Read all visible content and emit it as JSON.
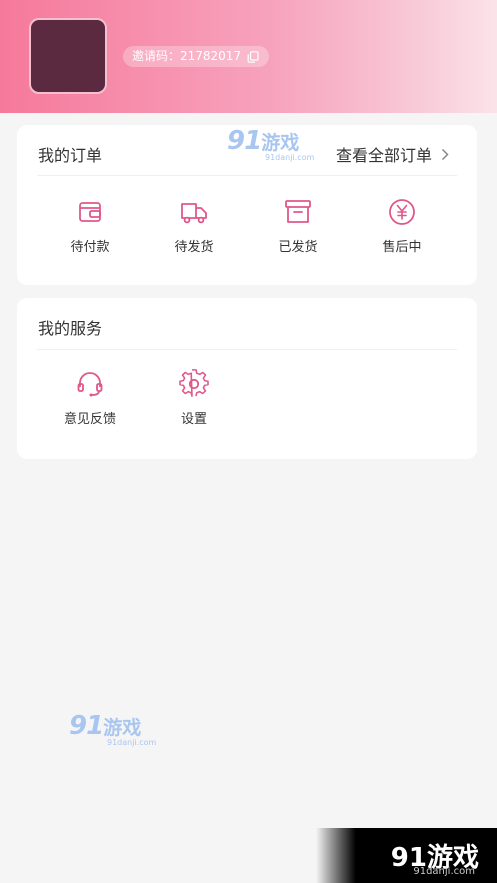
{
  "header": {
    "invite_label": "邀请码：21782017",
    "copy_icon": "copy-icon"
  },
  "orders": {
    "title": "我的订单",
    "view_all": "查看全部订单",
    "items": [
      {
        "label": "待付款",
        "icon": "wallet-icon"
      },
      {
        "label": "待发货",
        "icon": "truck-icon"
      },
      {
        "label": "已发货",
        "icon": "box-icon"
      },
      {
        "label": "售后中",
        "icon": "yen-circle-icon"
      }
    ]
  },
  "services": {
    "title": "我的服务",
    "items": [
      {
        "label": "意见反馈",
        "icon": "headset-icon"
      },
      {
        "label": "设置",
        "icon": "gear-icon"
      }
    ]
  },
  "watermark": {
    "logo": "91",
    "name": "游戏",
    "site": "91danji.com"
  },
  "colors": {
    "accent": "#e0588a",
    "header_start": "#f6799b",
    "header_end": "#fbe3ea"
  }
}
